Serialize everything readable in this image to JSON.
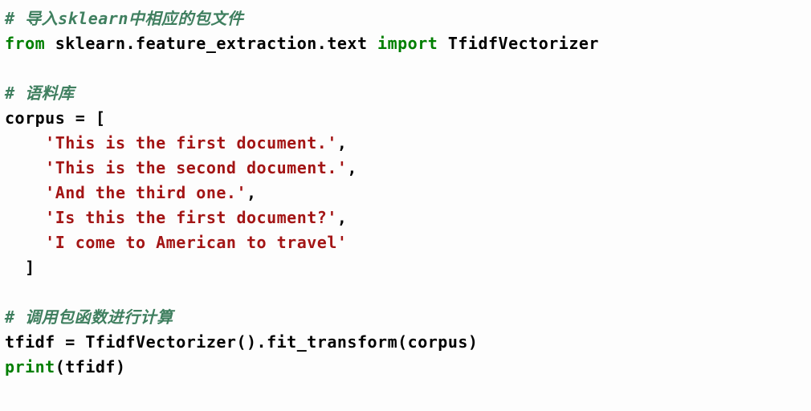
{
  "lines": {
    "l1": {
      "comment": "# 导入sklearn中相应的包文件"
    },
    "l2": {
      "kw_from": "from",
      "mod": "sklearn.feature_extraction.text",
      "kw_import": "import",
      "name": "TfidfVectorizer"
    },
    "l3": {
      "blank": ""
    },
    "l4": {
      "comment": "# 语料库"
    },
    "l5": {
      "var": "corpus",
      "eq": " = ",
      "open": "["
    },
    "l6": {
      "indent": "    ",
      "str": "'This is the first document.'",
      "comma": ","
    },
    "l7": {
      "indent": "    ",
      "str": "'This is the second document.'",
      "comma": ","
    },
    "l8": {
      "indent": "    ",
      "str": "'And the third one.'",
      "comma": ","
    },
    "l9": {
      "indent": "    ",
      "str": "'Is this the first document?'",
      "comma": ","
    },
    "l10": {
      "indent": "    ",
      "str": "'I come to American to travel'"
    },
    "l11": {
      "indent": "  ",
      "close": "]"
    },
    "l12": {
      "blank": ""
    },
    "l13": {
      "comment": "# 调用包函数进行计算"
    },
    "l14": {
      "var": "tfidf",
      "eq": " = ",
      "call": "TfidfVectorizer().fit_transform(corpus)"
    },
    "l15": {
      "fn": "print",
      "args": "(tfidf)"
    }
  }
}
